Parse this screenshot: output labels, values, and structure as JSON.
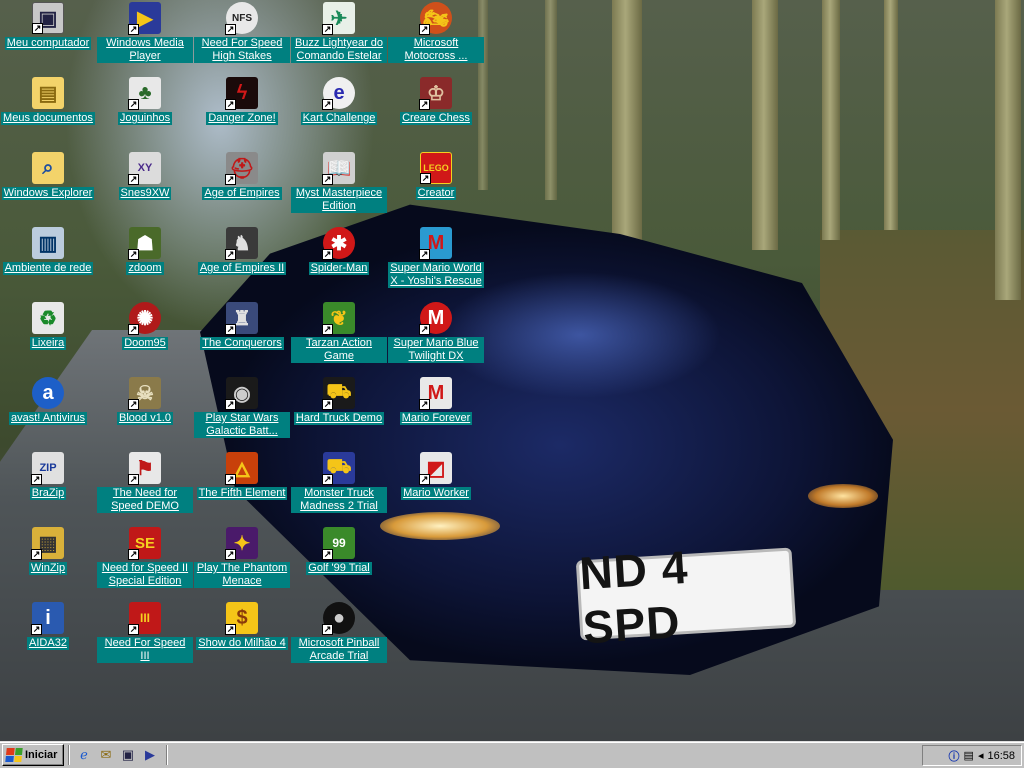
{
  "desktop": {
    "wallpaper": "car-on-forest-road",
    "plate_text": "ND 4 SPD",
    "icons": [
      {
        "label": "Meu computador",
        "icon": "my-computer-icon"
      },
      {
        "label": "Meus documentos",
        "icon": "my-documents-icon"
      },
      {
        "label": "Windows Explorer",
        "icon": "explorer-icon"
      },
      {
        "label": "Ambiente de rede",
        "icon": "network-icon"
      },
      {
        "label": "Lixeira",
        "icon": "recycle-bin-icon"
      },
      {
        "label": "avast! Antivirus",
        "icon": "avast-icon"
      },
      {
        "label": "BraZip",
        "icon": "brazip-icon"
      },
      {
        "label": "WinZip",
        "icon": "winzip-icon"
      },
      {
        "label": "AIDA32",
        "icon": "aida32-icon"
      },
      {
        "label": "Windows Media Player",
        "icon": "media-player-icon"
      },
      {
        "label": "Joguinhos",
        "icon": "cards-icon"
      },
      {
        "label": "Snes9XW",
        "icon": "snes-icon"
      },
      {
        "label": "zdoom",
        "icon": "doom-marine-icon"
      },
      {
        "label": "Doom95",
        "icon": "doom-icon"
      },
      {
        "label": "Blood v1.0",
        "icon": "skull-icon"
      },
      {
        "label": "The Need for Speed DEMO",
        "icon": "checkered-flag-icon"
      },
      {
        "label": "Need for Speed II Special Edition",
        "icon": "nfs2se-icon"
      },
      {
        "label": "Need For Speed III",
        "icon": "nfs3-icon"
      },
      {
        "label": "Need For Speed High Stakes",
        "icon": "nfs-logo-icon"
      },
      {
        "label": "Danger Zone!",
        "icon": "danger-zone-icon"
      },
      {
        "label": "Age of Empires",
        "icon": "helmet-icon"
      },
      {
        "label": "Age of Empires II",
        "icon": "knight-icon"
      },
      {
        "label": "The Conquerors",
        "icon": "conquerors-icon"
      },
      {
        "label": "Play Star Wars Galactic Batt...",
        "icon": "star-wars-icon"
      },
      {
        "label": "The Fifth Element",
        "icon": "fifth-element-icon"
      },
      {
        "label": "Play The Phantom Menace",
        "icon": "phantom-menace-icon"
      },
      {
        "label": "Show do Milhão 4",
        "icon": "show-do-milhao-icon"
      },
      {
        "label": "Buzz Lightyear do Comando Estelar",
        "icon": "buzz-lightyear-icon"
      },
      {
        "label": "Kart Challenge",
        "icon": "kart-challenge-icon"
      },
      {
        "label": "Myst Masterpiece Edition",
        "icon": "myst-book-icon"
      },
      {
        "label": "Spider-Man",
        "icon": "spider-man-icon"
      },
      {
        "label": "Tarzan Action Game",
        "icon": "tarzan-icon"
      },
      {
        "label": "Hard Truck Demo",
        "icon": "truck-icon"
      },
      {
        "label": "Monster Truck Madness 2 Trial",
        "icon": "monster-truck-icon"
      },
      {
        "label": "Golf '99 Trial",
        "icon": "golf-icon"
      },
      {
        "label": "Microsoft Pinball Arcade Trial",
        "icon": "pinball-icon"
      },
      {
        "label": "Microsoft Motocross ...",
        "icon": "motocross-icon"
      },
      {
        "label": "Creare Chess",
        "icon": "chess-icon"
      },
      {
        "label": "Creator",
        "icon": "lego-icon"
      },
      {
        "label": "Super Mario World X - Yoshi's Rescue",
        "icon": "mario-icon"
      },
      {
        "label": "Super Mario Blue Twilight DX",
        "icon": "mario-blue-icon"
      },
      {
        "label": "Mario Forever",
        "icon": "mario-forever-icon"
      },
      {
        "label": "Mario Worker",
        "icon": "mario-worker-icon"
      }
    ]
  },
  "taskbar": {
    "start_label": "Iniciar",
    "quick_launch": [
      "ie-icon",
      "outlook-express-icon",
      "show-desktop-icon",
      "media-player-icon"
    ],
    "tray_icons": [
      "info-icon",
      "network-tray-icon",
      "volume-icon"
    ],
    "clock": "16:58"
  }
}
